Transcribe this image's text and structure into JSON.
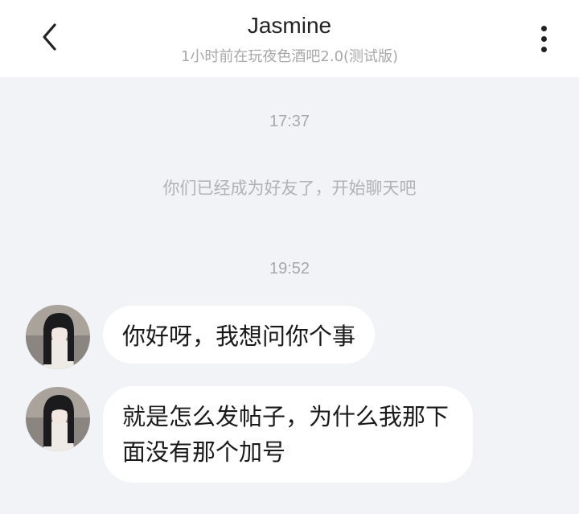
{
  "header": {
    "back_icon": "chevron-left-icon",
    "title": "Jasmine",
    "subtitle": "1小时前在玩夜色酒吧2.0(测试版)",
    "more_icon": "vertical-dots-icon"
  },
  "chat": {
    "time_1": "17:37",
    "system_message": "你们已经成为好友了，开始聊天吧",
    "time_2": "19:52",
    "messages": [
      {
        "sender": "Jasmine",
        "text": "你好呀，我想问你个事"
      },
      {
        "sender": "Jasmine",
        "text": "就是怎么发帖子，为什么我那下面没有那个加号"
      }
    ]
  },
  "colors": {
    "header_bg": "#ffffff",
    "chat_bg": "#f2f3f7",
    "bubble_bg": "#ffffff",
    "muted_text": "#a8a8a8"
  }
}
